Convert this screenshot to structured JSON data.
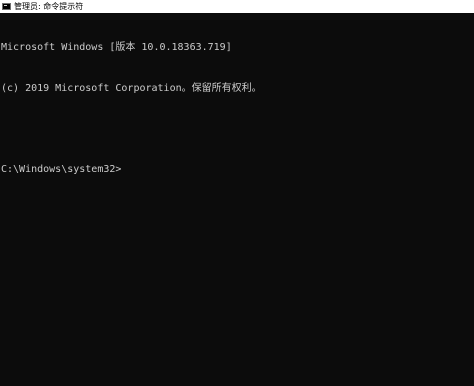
{
  "window": {
    "title": "管理员: 命令提示符",
    "icon": "cmd-icon"
  },
  "console": {
    "lines": [
      "Microsoft Windows [版本 10.0.18363.719]",
      "(c) 2019 Microsoft Corporation。保留所有权利。",
      "",
      "C:\\Windows\\system32>"
    ]
  },
  "colors": {
    "background": "#0c0c0c",
    "text": "#cccccc",
    "titlebar": "#ffffff"
  }
}
